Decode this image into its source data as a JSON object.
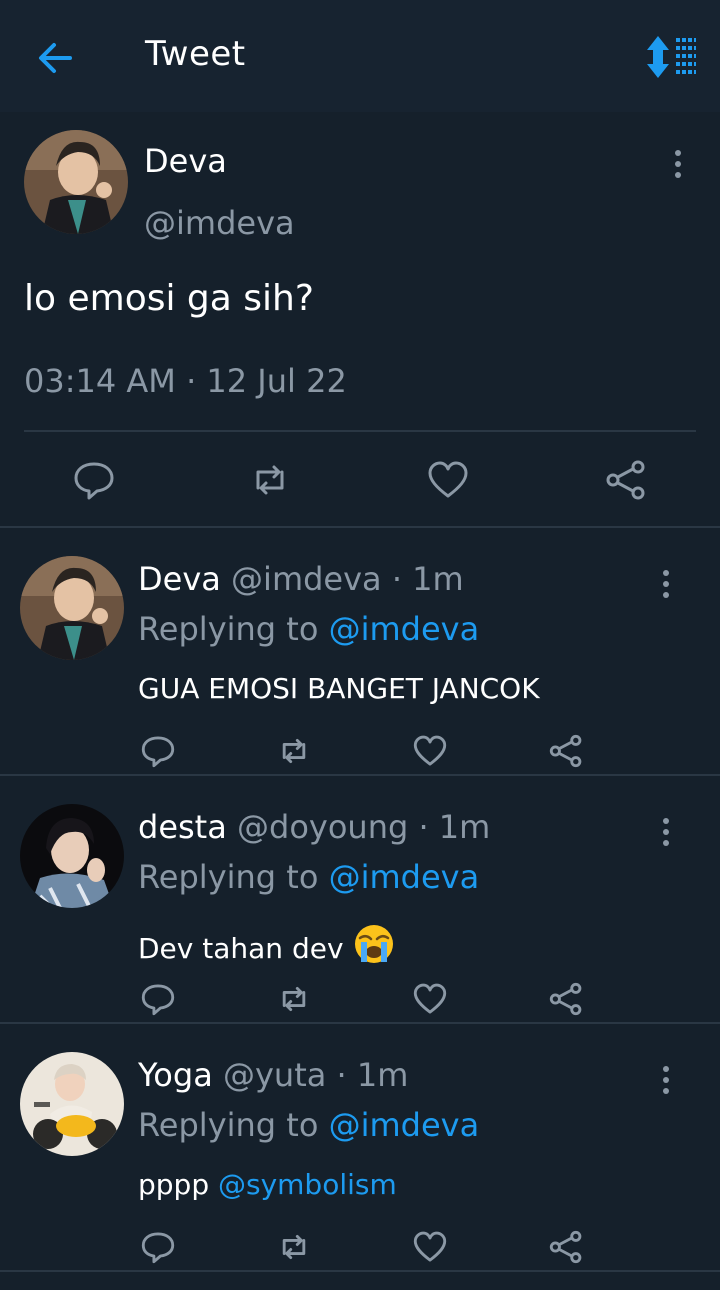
{
  "header": {
    "title": "Tweet"
  },
  "main_tweet": {
    "name": "Deva",
    "handle": "@imdeva",
    "text": "lo emosi ga sih?",
    "timestamp": "03:14 AM · 12 Jul 22"
  },
  "replies": [
    {
      "name": "Deva",
      "handle": "@imdeva",
      "time": "· 1m",
      "replying_prefix": "Replying to ",
      "replying_to": "@imdeva",
      "text": "GUA EMOSI BANGET JANCOK"
    },
    {
      "name": "desta",
      "handle": "@doyoung",
      "time": "· 1m",
      "replying_prefix": "Replying to ",
      "replying_to": "@imdeva",
      "text": "Dev tahan dev "
    },
    {
      "name": "Yoga",
      "handle": "@yuta",
      "time": "· 1m",
      "replying_prefix": "Replying to ",
      "replying_to": "@imdeva",
      "text": "pppp ",
      "mention": "@symbolism"
    }
  ],
  "icons": {
    "back": "arrow-left-icon",
    "sort": "sort-icon",
    "more": "more-vertical-icon",
    "reply": "comment-icon",
    "retweet": "retweet-icon",
    "like": "heart-icon",
    "share": "share-icon",
    "emoji": "loudly-crying-face-icon"
  },
  "colors": {
    "background": "#15202b",
    "accent": "#1d9bf0",
    "muted": "#8b98a5"
  }
}
